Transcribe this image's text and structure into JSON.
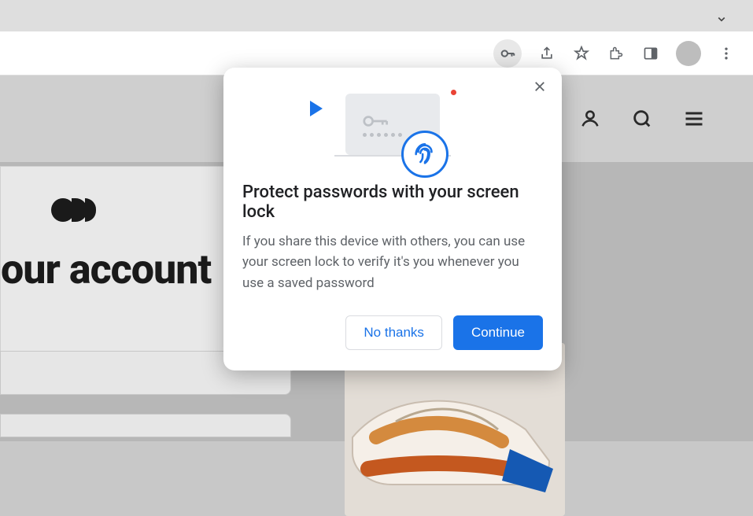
{
  "dialog": {
    "title": "Protect passwords with your screen lock",
    "body": "If you share this device with others, you can use your screen lock to verify it's you whenever you use a saved password",
    "secondary_label": "No thanks",
    "primary_label": "Continue"
  },
  "page": {
    "heading": "our account"
  },
  "toolbar": {
    "icons": [
      "key",
      "share",
      "star",
      "extensions",
      "panel",
      "avatar",
      "menu"
    ]
  }
}
